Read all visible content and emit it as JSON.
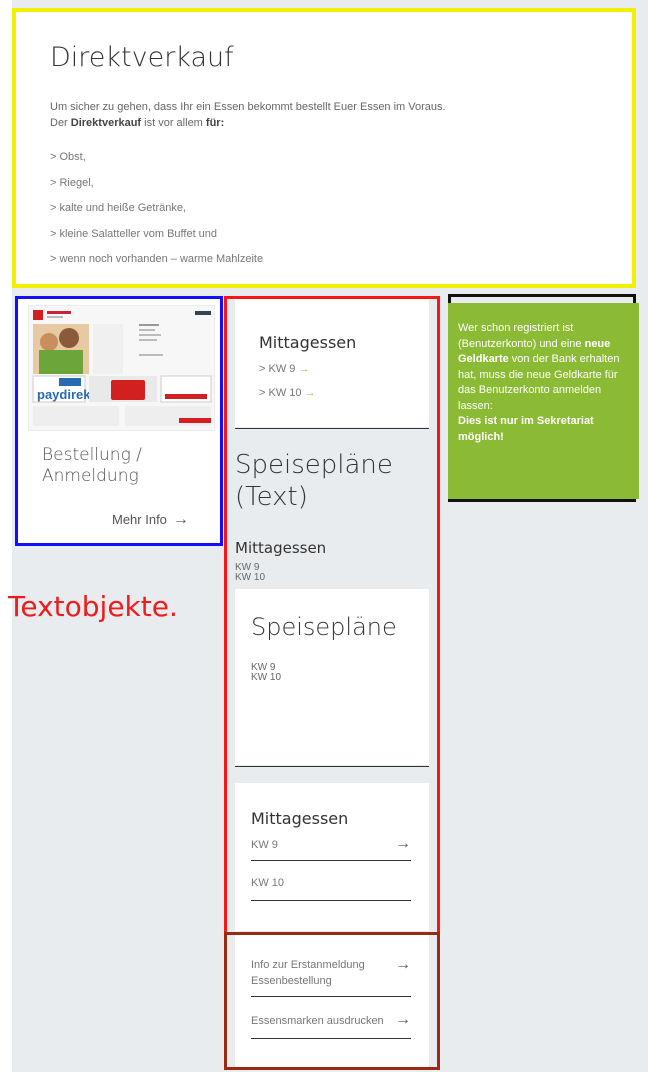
{
  "intro": {
    "title": "Direktverkauf",
    "line1": "Um sicher zu gehen, dass Ihr ein Essen bekommt bestellt Euer Essen im Voraus.",
    "line2_prefix": "Der ",
    "line2_bold": "Direktverkauf",
    "line2_mid": " ist vor allem ",
    "line2_bold2": "für:",
    "items": [
      "> Obst,",
      "> Riegel,",
      "> kalte und heiße Getränke,",
      "> kleine Salatteller vom Buffet und",
      "> wenn noch vorhanden – warme Mahlzeite"
    ]
  },
  "order_card": {
    "title": "Bestellung / Anmeldung",
    "more": "Mehr Info",
    "arrow": "→",
    "thumb_logo": "paydirekt"
  },
  "label": "Textobjekte.",
  "mittagessen_card": {
    "title": "Mittagessen",
    "kw9": "> KW 9",
    "kw10": "> KW 10",
    "arrow": "→"
  },
  "speiseplaene_text": {
    "title": "Speisepläne (Text)",
    "sub": "Mittagessen",
    "kw9": "KW 9",
    "kw10": "KW 10"
  },
  "speiseplaene_card": {
    "title": "Speisepläne",
    "kw9": "KW 9",
    "kw10": "KW 10"
  },
  "mittagessen_list": {
    "title": "Mittagessen",
    "rows": [
      "KW 9",
      "KW 10"
    ],
    "arrow": "→"
  },
  "links_card": {
    "rows": [
      "Info zur Erstanmeldung Essenbestellung",
      "Essensmarken ausdrucken"
    ],
    "arrow": "→"
  },
  "green_box": {
    "t1": "Wer schon registriert ist (Benutzerkonto) und eine ",
    "b1": "neue Geldkarte",
    "t2": " von der Bank erhalten hat, muss die neue Geldkarte für das Benutzerkonto anmelden lassen:",
    "b2": "Dies ist nur im Sekretariat möglich!"
  },
  "colors": {
    "yellow_frame": "#f2ef00",
    "blue_frame": "#1010ff",
    "red_frame": "#ff1414",
    "darkred_frame": "#9a2a12",
    "black_frame": "#111111",
    "green": "#8bbb34",
    "label_red": "#ee1c1c"
  }
}
